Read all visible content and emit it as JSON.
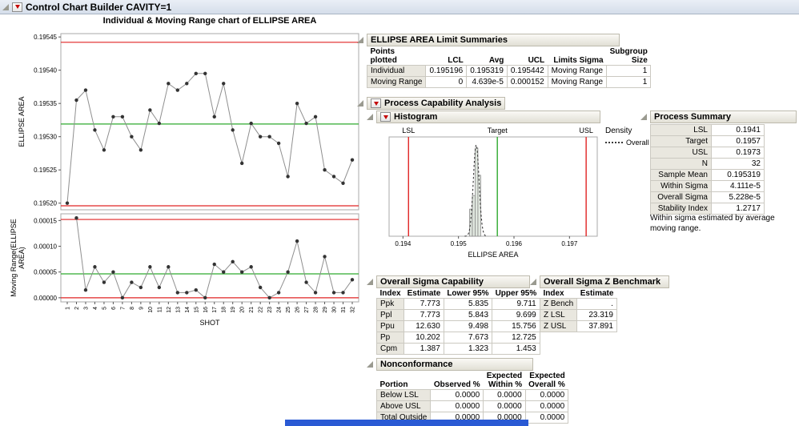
{
  "window_title": "Control Chart Builder CAVITY=1",
  "chart_data": {
    "imr": {
      "type": "line",
      "title": "Individual & Moving Range chart of ELLIPSE AREA",
      "xlabel": "SHOT",
      "shots": [
        1,
        2,
        3,
        4,
        5,
        6,
        7,
        8,
        9,
        10,
        11,
        12,
        13,
        14,
        15,
        16,
        17,
        18,
        19,
        20,
        21,
        22,
        23,
        24,
        25,
        26,
        27,
        28,
        29,
        30,
        31,
        32
      ],
      "individual": {
        "ylabel": "ELLIPSE AREA",
        "ylim": [
          0.19519,
          0.195455
        ],
        "yticks": [
          0.1952,
          0.19525,
          0.1953,
          0.19535,
          0.1954,
          0.19545
        ],
        "tick_decimals": 5,
        "lcl": 0.195196,
        "avg": 0.195319,
        "ucl": 0.195442,
        "values": [
          0.1952,
          0.195355,
          0.19537,
          0.19531,
          0.19528,
          0.19533,
          0.19533,
          0.1953,
          0.19528,
          0.19534,
          0.19532,
          0.19538,
          0.19537,
          0.19538,
          0.195395,
          0.195395,
          0.19533,
          0.19538,
          0.19531,
          0.19526,
          0.19532,
          0.1953,
          0.1953,
          0.19529,
          0.19524,
          0.19535,
          0.19532,
          0.19533,
          0.19525,
          0.19524,
          0.19523,
          0.195265
        ]
      },
      "moving_range": {
        "ylabel": "Moving Range(ELLIPSE AREA)",
        "ylim": [
          -8e-06,
          0.000163
        ],
        "yticks": [
          0,
          5e-05,
          0.0001,
          0.00015
        ],
        "tick_decimals": 5,
        "lcl": 0,
        "avg": 4.639e-05,
        "ucl": 0.000152,
        "values": [
          null,
          0.000155,
          1.5e-05,
          6e-05,
          3e-05,
          5e-05,
          0,
          3e-05,
          2e-05,
          6e-05,
          2e-05,
          6e-05,
          1e-05,
          1e-05,
          1.5e-05,
          0,
          6.5e-05,
          5e-05,
          7e-05,
          5e-05,
          6e-05,
          2e-05,
          0,
          1e-05,
          5e-05,
          0.00011,
          3e-05,
          1e-05,
          8e-05,
          1e-05,
          1e-05,
          3.5e-05
        ]
      }
    },
    "histogram": {
      "type": "bar",
      "title": "Histogram",
      "xlabel": "ELLIPSE AREA",
      "xlim": [
        0.19375,
        0.1975
      ],
      "xticks": [
        0.194,
        0.195,
        0.196,
        0.197
      ],
      "tick_decimals": 3,
      "lsl": 0.1941,
      "target": 0.1957,
      "usl": 0.1973,
      "labels": {
        "lsl": "LSL",
        "target": "Target",
        "usl": "USL"
      },
      "bins": {
        "start": 0.1952,
        "width": 5e-05,
        "counts": [
          4,
          6,
          13,
          9
        ]
      },
      "density": {
        "mean": 0.195319,
        "sigma": 5.228e-05
      },
      "legend": {
        "title": "Density",
        "entries": [
          {
            "label": "Overall",
            "style": "dotted"
          }
        ]
      }
    }
  },
  "limit_summaries": {
    "title": "ELLIPSE AREA Limit Summaries",
    "columns": [
      "Points\nplotted",
      "LCL",
      "Avg",
      "UCL",
      "Limits Sigma",
      "Subgroup\nSize"
    ],
    "rows": [
      [
        "Individual",
        "0.195196",
        "0.195319",
        "0.195442",
        "Moving Range",
        "1"
      ],
      [
        "Moving Range",
        "0",
        "4.639e-5",
        "0.000152",
        "Moving Range",
        "1"
      ]
    ]
  },
  "pca": {
    "title": "Process Capability Analysis"
  },
  "process_summary": {
    "title": "Process Summary",
    "rows": [
      [
        "LSL",
        "0.1941"
      ],
      [
        "Target",
        "0.1957"
      ],
      [
        "USL",
        "0.1973"
      ],
      [
        "N",
        "32"
      ],
      [
        "Sample Mean",
        "0.195319"
      ],
      [
        "Within Sigma",
        "4.111e-5"
      ],
      [
        "Overall Sigma",
        "5.228e-5"
      ],
      [
        "Stability Index",
        "1.2717"
      ]
    ],
    "note": "Within sigma estimated by average moving range."
  },
  "sigma_capability": {
    "title": "Overall Sigma Capability",
    "columns": [
      "Index",
      "Estimate",
      "Lower 95%",
      "Upper 95%"
    ],
    "rows": [
      [
        "Ppk",
        "7.773",
        "5.835",
        "9.711"
      ],
      [
        "Ppl",
        "7.773",
        "5.843",
        "9.699"
      ],
      [
        "Ppu",
        "12.630",
        "9.498",
        "15.756"
      ],
      [
        "Pp",
        "10.202",
        "7.673",
        "12.725"
      ],
      [
        "Cpm",
        "1.387",
        "1.323",
        "1.453"
      ]
    ]
  },
  "z_benchmark": {
    "title": "Overall Sigma Z Benchmark",
    "columns": [
      "Index",
      "Estimate"
    ],
    "rows": [
      [
        "Z Bench",
        "."
      ],
      [
        "Z LSL",
        "23.319"
      ],
      [
        "Z USL",
        "37.891"
      ]
    ]
  },
  "nonconformance": {
    "title": "Nonconformance",
    "columns": [
      "Portion",
      "Observed %",
      "Expected\nWithin %",
      "Expected\nOverall %"
    ],
    "rows": [
      [
        "Below LSL",
        "0.0000",
        "0.0000",
        "0.0000"
      ],
      [
        "Above USL",
        "0.0000",
        "0.0000",
        "0.0000"
      ],
      [
        "Total Outside",
        "0.0000",
        "0.0000",
        "0.0000"
      ]
    ]
  }
}
